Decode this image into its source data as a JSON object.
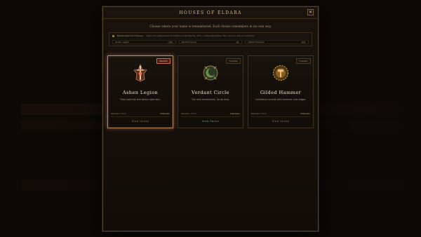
{
  "modal": {
    "title": "Houses of Eldara",
    "close_label": "✕",
    "subtitle": "Choose where your name is remembered. Each House remembers in its own way."
  },
  "filter": {
    "label": "Remembered Houses",
    "hint": "Learn the oaths bound to Eldara's elder bloods. 40% + obtainable titles. Two can join now or condemn.",
    "items": [
      {
        "label": "Ashen Legion",
        "count": "12"
      },
      {
        "label": "Verdant Circle",
        "count": "9"
      },
      {
        "label": "Gilded Hammer",
        "count": "14"
      }
    ]
  },
  "cards": [
    {
      "name": "Ashen Legion",
      "tag": "Selected",
      "desc": "They hold the line where light fails.",
      "members": "Members 3,677",
      "rank": "Champion",
      "link": "View House",
      "emblem": "sword-crest-icon",
      "accent": "#d06a55"
    },
    {
      "name": "Verdant Circle",
      "tag": "Forsaken",
      "desc": "The wild remembers. So do they.",
      "members": "Members 3,677",
      "rank": "Champion",
      "link": "View House",
      "emblem": "moon-crest-icon",
      "accent": "#6fa58e"
    },
    {
      "name": "Gilded Hammer",
      "tag": "Forsaken",
      "desc": "Civilization is built with hammer and ledger.",
      "members": "Members 3,677",
      "rank": "Champion",
      "link": "View House",
      "emblem": "gear-crest-icon",
      "accent": "#d1a146"
    }
  ]
}
